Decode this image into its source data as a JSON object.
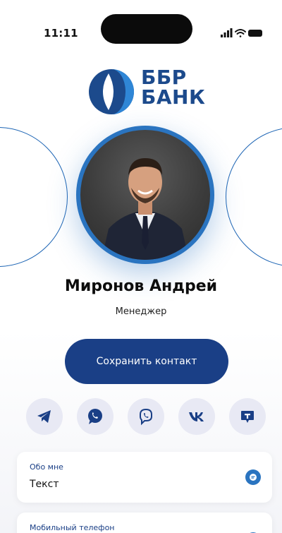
{
  "status_bar": {
    "time": "11:11",
    "icons": [
      "signal-icon",
      "wifi-icon",
      "battery-icon"
    ]
  },
  "logo": {
    "line1": "ББР",
    "line2": "БАНК",
    "brand_color": "#1c4a8c"
  },
  "profile": {
    "name": "Миронов Андрей",
    "role": "Менеджер"
  },
  "actions": {
    "save_label": "Сохранить контакт"
  },
  "social": [
    {
      "name": "telegram-icon"
    },
    {
      "name": "whatsapp-icon"
    },
    {
      "name": "viber-icon"
    },
    {
      "name": "vk-icon"
    },
    {
      "name": "tamtam-icon"
    }
  ],
  "cards": {
    "about": {
      "label": "Обо мне",
      "value": "Текст"
    },
    "phone": {
      "label": "Мобильный телефон",
      "value": ""
    }
  },
  "colors": {
    "accent": "#1a3f86",
    "accent_light": "#2a74c0",
    "social_bg": "#e8e9f4"
  }
}
